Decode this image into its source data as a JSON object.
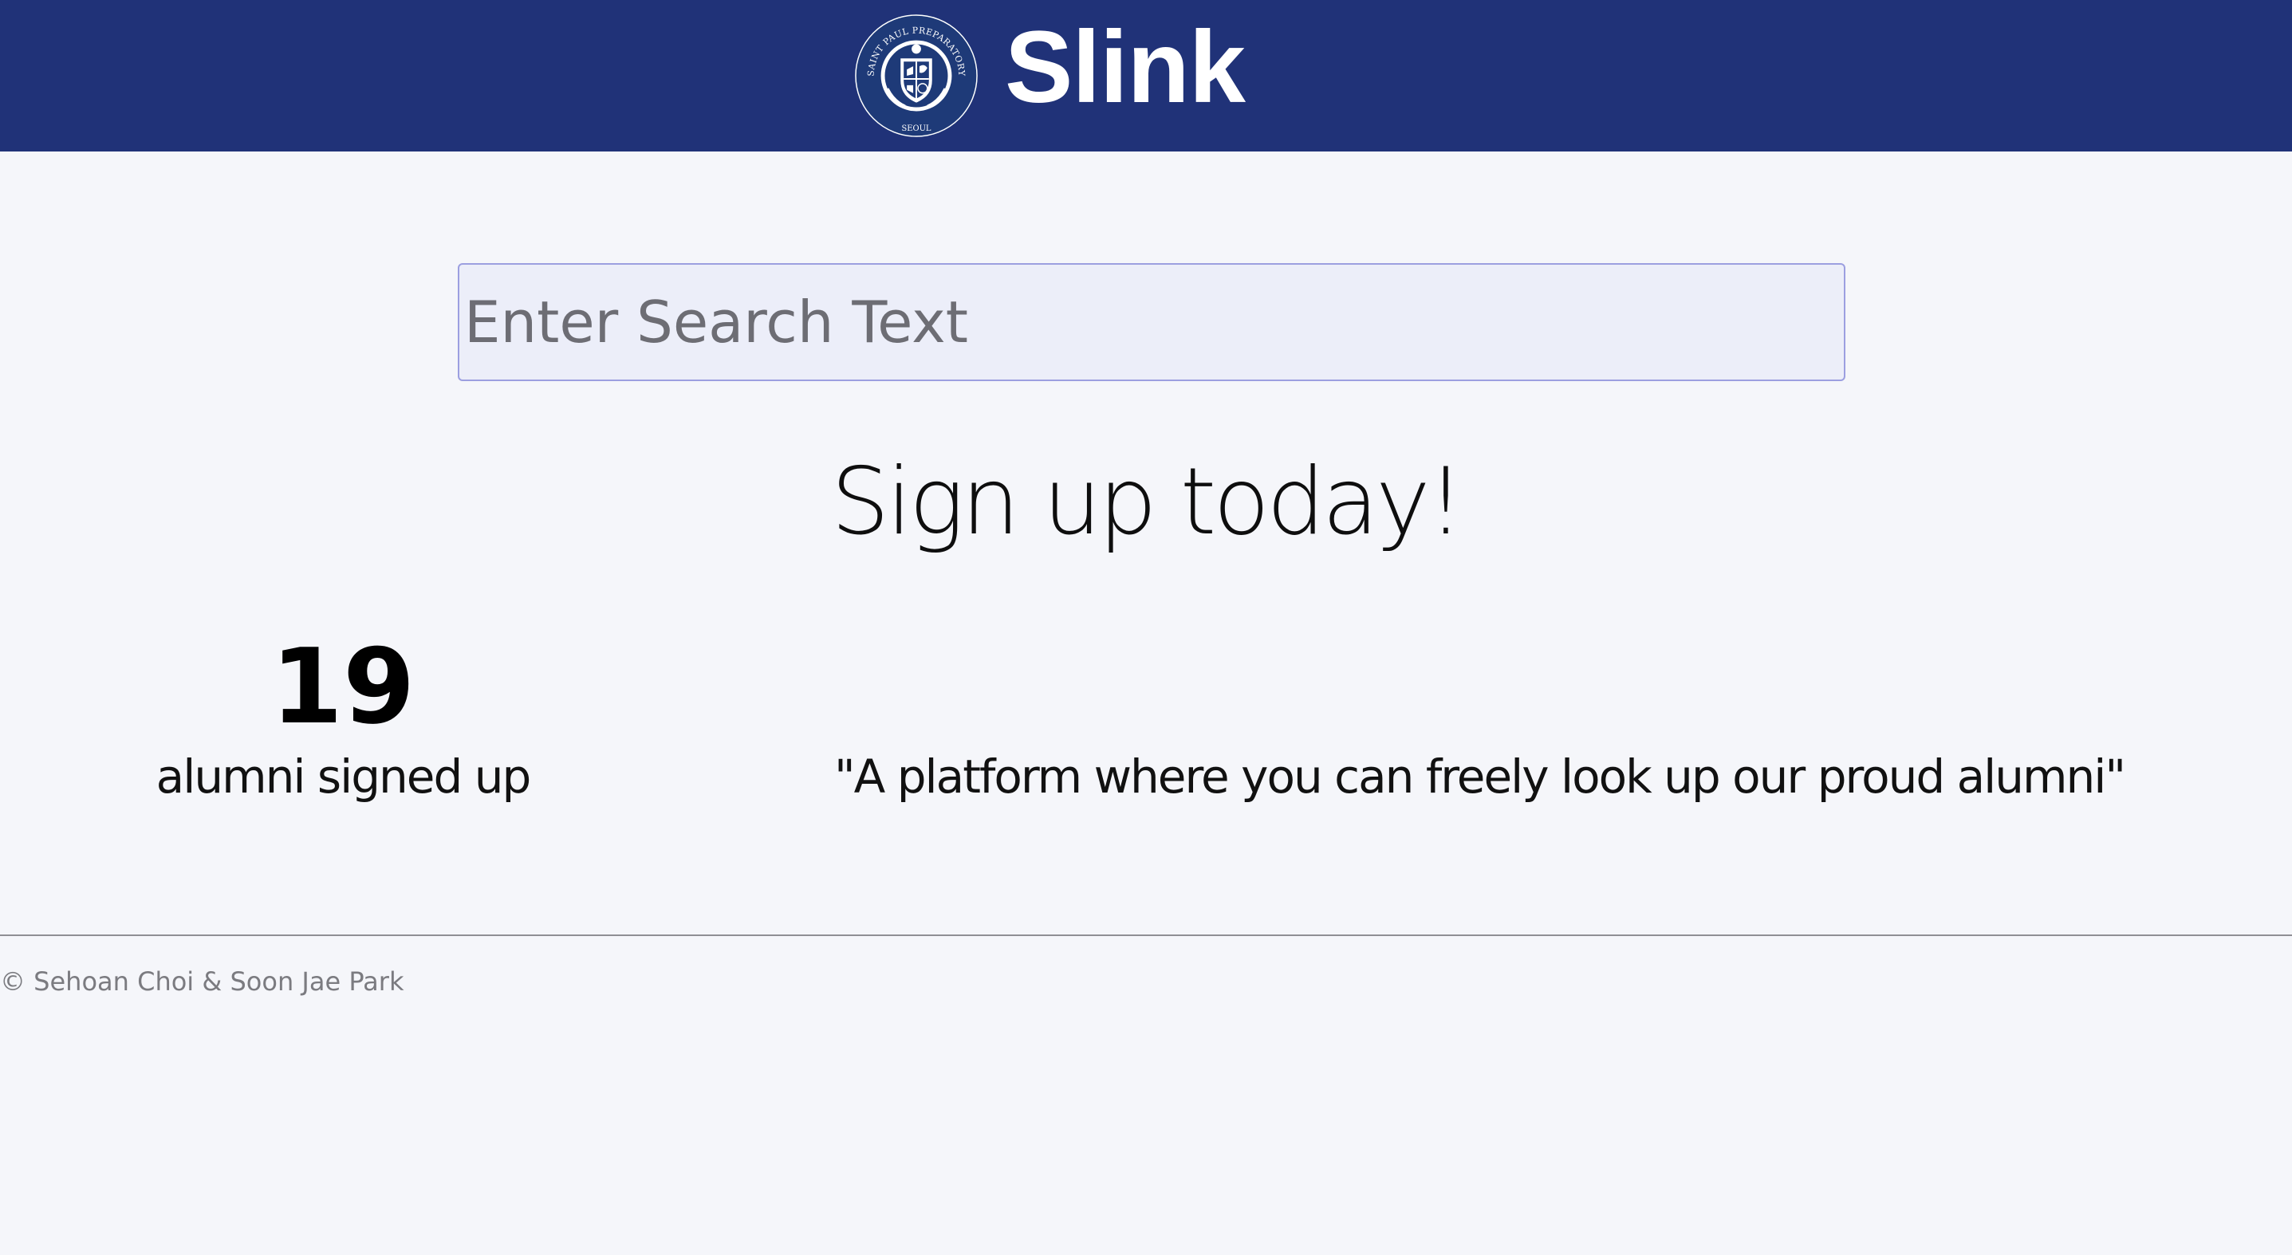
{
  "header": {
    "title": "Slink",
    "logo": {
      "icon": "school-crest-logo",
      "text_top": "SAINT PAUL PREPARATORY",
      "text_bottom": "SEOUL"
    }
  },
  "search": {
    "placeholder": "Enter Search Text",
    "value": ""
  },
  "hero": {
    "heading": "Sign up today!"
  },
  "stats": {
    "count": "19",
    "label": "alumni signed up"
  },
  "tagline": "\"A platform where you can freely look up our proud alumni\"",
  "footer": {
    "copyright": "© Sehoan Choi & Soon Jae Park"
  },
  "colors": {
    "header_bg": "#203278",
    "page_bg": "#f5f6fa",
    "search_bg": "#eceef9",
    "search_border": "#9c9fe0"
  }
}
